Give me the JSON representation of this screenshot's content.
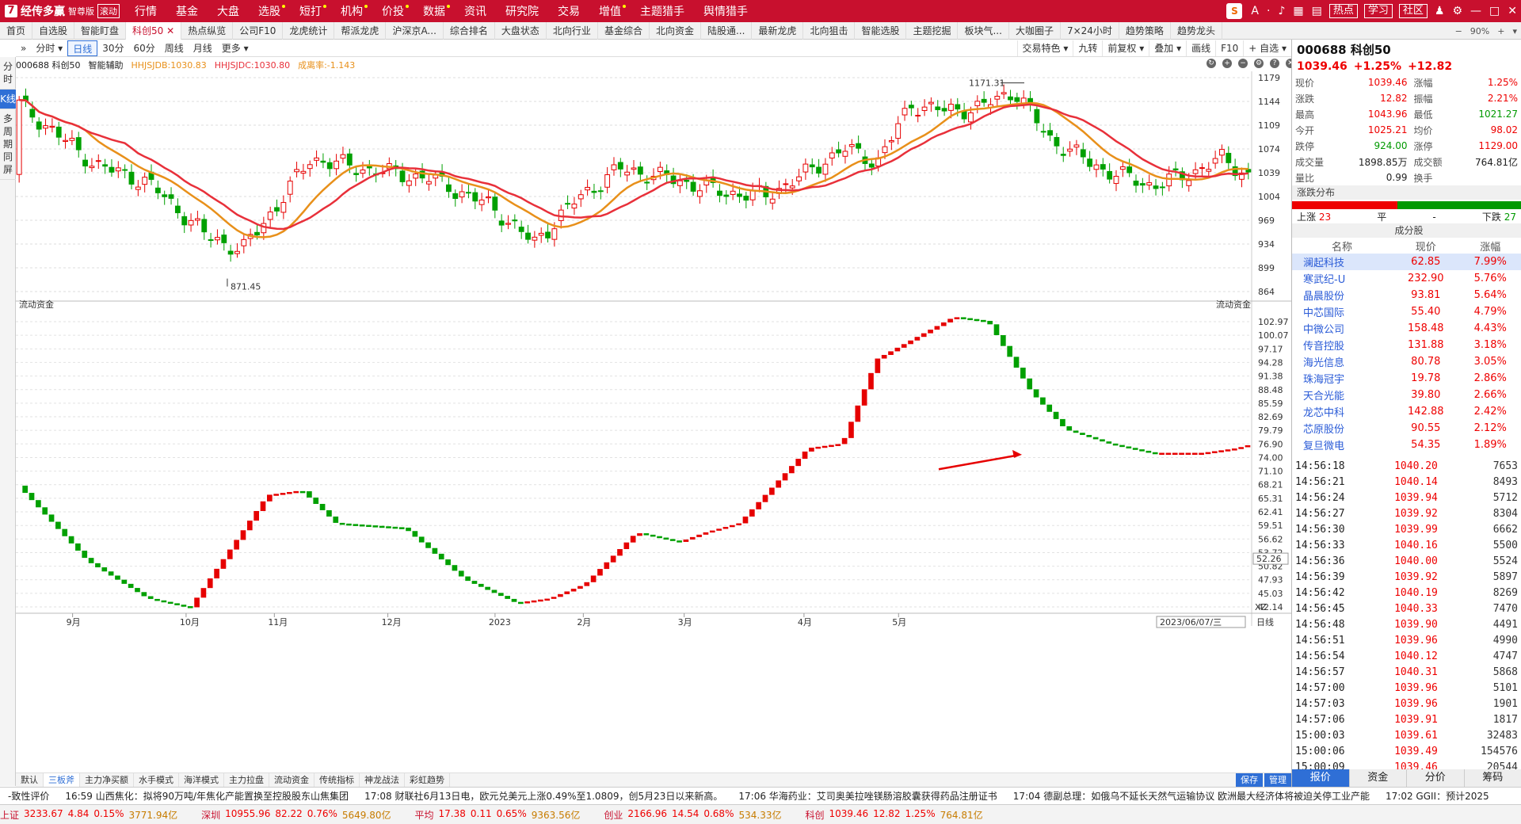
{
  "app": {
    "logo_mark": "7",
    "name": "经传多赢",
    "edition": "智尊版",
    "mode": "滚动"
  },
  "main_menu": [
    "行情",
    "基金",
    "大盘",
    "选股",
    "短打",
    "机构",
    "价投",
    "数据",
    "资讯",
    "研究院",
    "交易",
    "增值",
    "主题猎手",
    "舆情猎手"
  ],
  "top_right": {
    "search_mark": "S",
    "btn_hot": "热点",
    "btn_learn": "学习",
    "btn_community": "社区"
  },
  "tabs": [
    "首页",
    "自选股",
    "智能盯盘",
    "科创50",
    "热点纵览",
    "公司F10",
    "龙虎统计",
    "帮派龙虎",
    "沪深京A...",
    "综合排名",
    "大盘状态",
    "北向行业",
    "基金综合",
    "北向资金",
    "陆股通...",
    "最新龙虎",
    "北向狙击",
    "智能选股",
    "主题挖掘",
    "板块气...",
    "大咖圈子",
    "7×24小时",
    "趋势策略",
    "趋势龙头"
  ],
  "active_tab": "科创50",
  "tab_right": {
    "zoom": "90%"
  },
  "left_tabs": [
    "分时",
    "K线",
    "多周期同屏"
  ],
  "toolbar": {
    "left": [
      "分时",
      "日线",
      "30分",
      "60分",
      "周线",
      "月线",
      "更多"
    ],
    "active": "日线",
    "right": [
      "交易特色",
      "九转",
      "前复权",
      "叠加",
      "画线",
      "F10",
      "+ 自选"
    ]
  },
  "legend": {
    "code": "000688 科创50",
    "assist": "智能辅助",
    "l1": "HHJSJDB:1030.83",
    "l2": "HHJSJDC:1030.80",
    "l3": "成离率:-1.143"
  },
  "lower_pane_title": "流动资金",
  "main_axis": [
    "1179",
    "1144",
    "1109",
    "1074",
    "1039",
    "1004",
    "969",
    "934",
    "899",
    "864"
  ],
  "sub_axis": [
    "102.97",
    "100.07",
    "97.17",
    "94.28",
    "91.38",
    "88.48",
    "85.59",
    "82.69",
    "79.79",
    "76.90",
    "74.00",
    "71.10",
    "68.21",
    "65.31",
    "62.41",
    "59.51",
    "56.62",
    "53.72",
    "50.82",
    "47.93",
    "45.03",
    "42.14"
  ],
  "sub_last": "52.26",
  "high_label": "1171.31",
  "low_label": "871.45",
  "x_axis": [
    "9月",
    "10月",
    "11月",
    "12月",
    "2023",
    "2月",
    "3月",
    "4月",
    "5月"
  ],
  "x_date": "2023/06/07/三",
  "x_unit": "XZ",
  "bottom_tabs": [
    "默认",
    "三板斧",
    "主力净买额",
    "水手模式",
    "海洋模式",
    "主力拉盘",
    "流动资金",
    "传统指标",
    "神龙战法",
    "彩虹趋势"
  ],
  "bottom_right": [
    "保存",
    "管理"
  ],
  "day_label": "日线",
  "right": {
    "title": "000688 科创50",
    "price": "1039.46",
    "chg_pct": "+1.25%",
    "chg": "+12.82",
    "quote": [
      [
        "现价",
        "1039.46",
        "涨幅",
        "1.25%"
      ],
      [
        "涨跌",
        "12.82",
        "振幅",
        "2.21%"
      ],
      [
        "最高",
        "1043.96",
        "最低",
        "1021.27"
      ],
      [
        "今开",
        "1025.21",
        "均价",
        "98.02"
      ],
      [
        "跌停",
        "924.00",
        "涨停",
        "1129.00"
      ],
      [
        "成交量",
        "1898.85万",
        "成交额",
        "764.81亿"
      ],
      [
        "量比",
        "0.99",
        "换手",
        ""
      ]
    ],
    "dist_title": "涨跌分布",
    "up_label": "上涨",
    "up": "23",
    "flat_label": "平",
    "flat": "-",
    "down_label": "下跌",
    "down": "27",
    "comp_title": "成分股",
    "comp_head": [
      "名称",
      "现价",
      "涨幅"
    ],
    "comp": [
      [
        "澜起科技",
        "62.85",
        "7.99%"
      ],
      [
        "寒武纪-U",
        "232.90",
        "5.76%"
      ],
      [
        "晶晨股份",
        "93.81",
        "5.64%"
      ],
      [
        "中芯国际",
        "55.40",
        "4.79%"
      ],
      [
        "中微公司",
        "158.48",
        "4.43%"
      ],
      [
        "传音控股",
        "131.88",
        "3.18%"
      ],
      [
        "海光信息",
        "80.78",
        "3.05%"
      ],
      [
        "珠海冠宇",
        "19.78",
        "2.86%"
      ],
      [
        "天合光能",
        "39.80",
        "2.66%"
      ],
      [
        "龙芯中科",
        "142.88",
        "2.42%"
      ],
      [
        "芯原股份",
        "90.55",
        "2.12%"
      ],
      [
        "复旦微电",
        "54.35",
        "1.89%"
      ]
    ],
    "ticks": [
      [
        "14:56:18",
        "1040.20",
        "7653"
      ],
      [
        "14:56:21",
        "1040.14",
        "8493"
      ],
      [
        "14:56:24",
        "1039.94",
        "5712"
      ],
      [
        "14:56:27",
        "1039.92",
        "8304"
      ],
      [
        "14:56:30",
        "1039.99",
        "6662"
      ],
      [
        "14:56:33",
        "1040.16",
        "5500"
      ],
      [
        "14:56:36",
        "1040.00",
        "5524"
      ],
      [
        "14:56:39",
        "1039.92",
        "5897"
      ],
      [
        "14:56:42",
        "1040.19",
        "8269"
      ],
      [
        "14:56:45",
        "1040.33",
        "7470"
      ],
      [
        "14:56:48",
        "1039.90",
        "4491"
      ],
      [
        "14:56:51",
        "1039.96",
        "4990"
      ],
      [
        "14:56:54",
        "1040.12",
        "4747"
      ],
      [
        "14:56:57",
        "1040.31",
        "5868"
      ],
      [
        "14:57:00",
        "1039.96",
        "5101"
      ],
      [
        "14:57:03",
        "1039.96",
        "1901"
      ],
      [
        "14:57:06",
        "1039.91",
        "1817"
      ],
      [
        "15:00:03",
        "1039.61",
        "32483"
      ],
      [
        "15:00:06",
        "1039.49",
        "154576"
      ],
      [
        "15:00:09",
        "1039.46",
        "20544"
      ]
    ],
    "bottom_tabs": [
      "报价",
      "资金",
      "分价",
      "筹码"
    ]
  },
  "news": [
    "-致性评价",
    "16:59 山西焦化：拟将90万吨/年焦化产能置换至控股股东山焦集团",
    "17:08 财联社6月13日电，欧元兑美元上涨0.49%至1.0809，创5月23日以来新高。",
    "17:06 华海药业：艾司奥美拉唑镁肠溶胶囊获得药品注册证书",
    "17:04 德副总理：如俄乌不延长天然气运输协议 欧洲最大经济体将被迫关停工业产能",
    "17:02 GGII：预计2025"
  ],
  "status": [
    [
      "上证",
      "3233.67",
      "4.84",
      "0.15%",
      "3771.94亿"
    ],
    [
      "深圳",
      "10955.96",
      "82.22",
      "0.76%",
      "5649.80亿"
    ],
    [
      "平均",
      "17.38",
      "0.11",
      "0.65%",
      "9363.56亿"
    ],
    [
      "创业",
      "2166.96",
      "14.54",
      "0.68%",
      "534.33亿"
    ],
    [
      "科创",
      "1039.46",
      "12.82",
      "1.25%",
      "764.81亿"
    ]
  ],
  "colors": {
    "up": "#e60000",
    "down": "#00a000",
    "brand": "#c8102e",
    "accent": "#2f6fd6",
    "ma1": "#e8303a",
    "ma2": "#e8901a"
  }
}
